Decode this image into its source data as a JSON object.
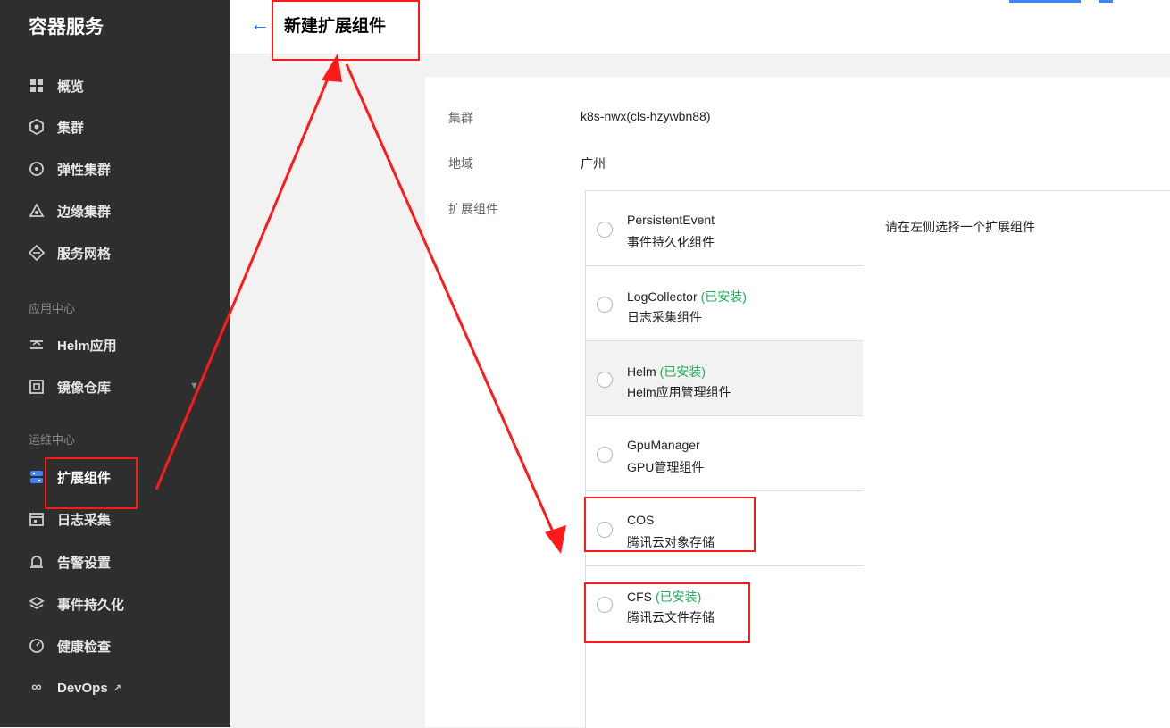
{
  "sidebar": {
    "title": "容器服务",
    "items": [
      {
        "label": "概览",
        "icon": "grid-icon"
      },
      {
        "label": "集群",
        "icon": "cluster-icon"
      },
      {
        "label": "弹性集群",
        "icon": "elastic-icon"
      },
      {
        "label": "边缘集群",
        "icon": "edge-icon"
      },
      {
        "label": "服务网格",
        "icon": "mesh-icon"
      }
    ],
    "section_app": "应用中心",
    "app_items": [
      {
        "label": "Helm应用",
        "icon": "helm-icon"
      },
      {
        "label": "镜像仓库",
        "icon": "registry-icon"
      }
    ],
    "section_ops": "运维中心",
    "ops_items": [
      {
        "label": "扩展组件",
        "icon": "addon-icon"
      },
      {
        "label": "日志采集",
        "icon": "calendar-icon"
      },
      {
        "label": "告警设置",
        "icon": "alarm-icon"
      },
      {
        "label": "事件持久化",
        "icon": "layers-icon"
      },
      {
        "label": "健康检查",
        "icon": "health-icon"
      },
      {
        "label": "DevOps",
        "icon": "infinity-icon"
      }
    ]
  },
  "header": {
    "back_icon": "←",
    "title": "新建扩展组件"
  },
  "form": {
    "cluster_label": "集群",
    "cluster_value": "k8s-nwx(cls-hzywbn88)",
    "region_label": "地域",
    "region_value": "广州",
    "addon_label": "扩展组件",
    "detail_placeholder": "请在左侧选择一个扩展组件",
    "addons": [
      {
        "name": "PersistentEvent",
        "installed": "",
        "desc": "事件持久化组件"
      },
      {
        "name": "LogCollector",
        "installed": "(已安装)",
        "desc": "日志采集组件"
      },
      {
        "name": "Helm",
        "installed": "(已安装)",
        "desc": "Helm应用管理组件"
      },
      {
        "name": "GpuManager",
        "installed": "",
        "desc": "GPU管理组件"
      },
      {
        "name": "COS",
        "installed": "",
        "desc": "腾讯云对象存储"
      },
      {
        "name": "CFS",
        "installed": "(已安装)",
        "desc": "腾讯云文件存储"
      }
    ]
  },
  "colors": {
    "sidebar_bg": "#2e2e2e",
    "accent": "#006eff",
    "installed": "#1aad55",
    "annotation": "#ff1a1a"
  }
}
